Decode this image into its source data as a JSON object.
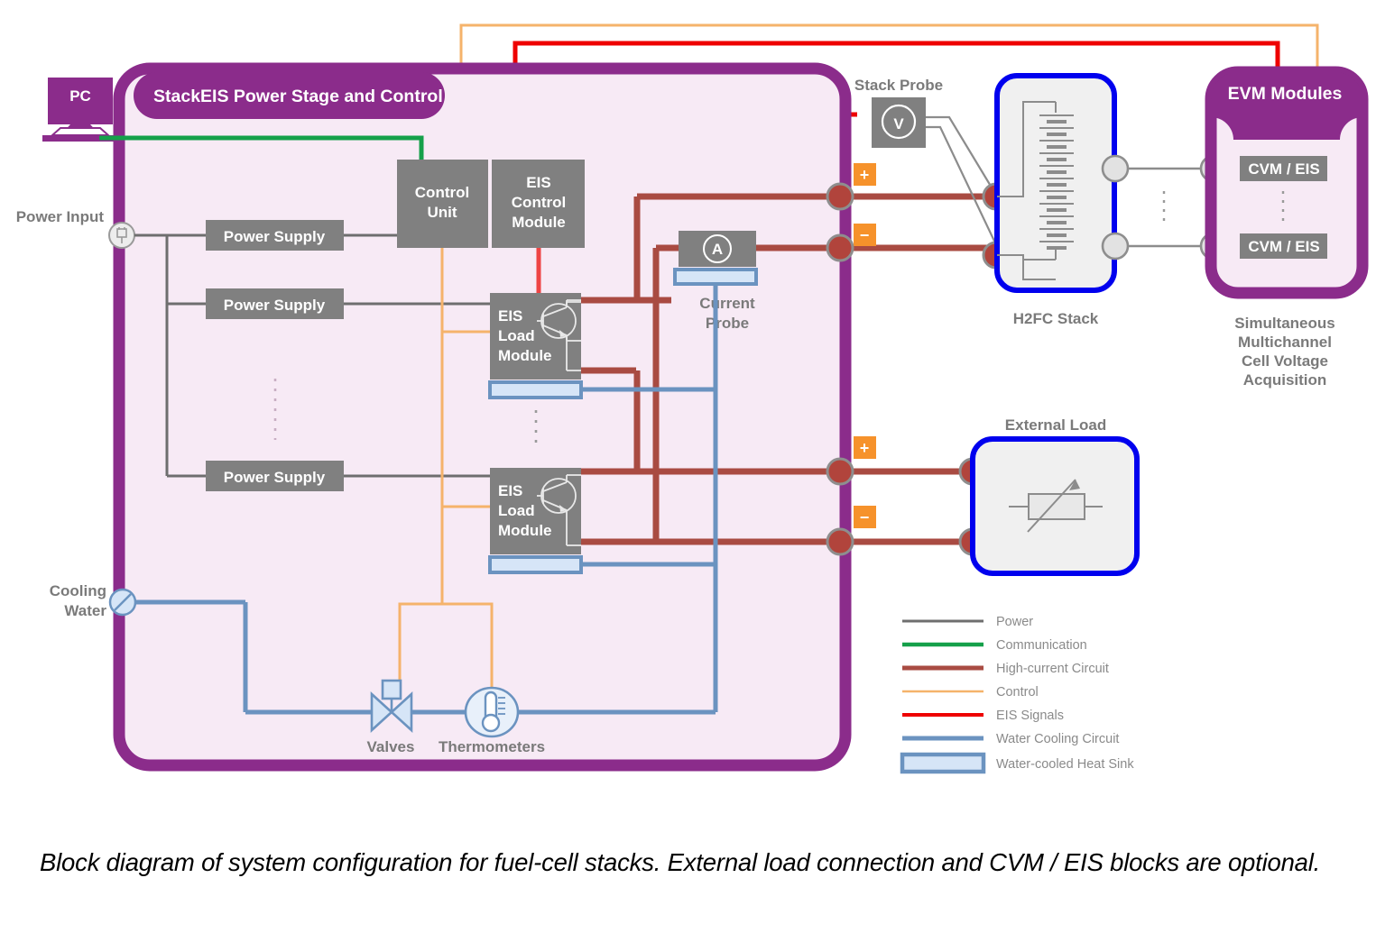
{
  "diagram": {
    "title": "Block diagram of system configuration for fuel-cell stacks",
    "caption": "Block diagram of system configuration for fuel-cell stacks. External load connection and CVM / EIS blocks are optional."
  },
  "colors": {
    "purple": "#8B2C8B",
    "purple_fill": "#F7EAF5",
    "grey_block": "#808080",
    "power_line": "#6E6E6E",
    "communication": "#15A04A",
    "high_current": "#A94B42",
    "control": "#F5B36B",
    "eis_signal": "#EE0000",
    "water_cooling": "#6B93C0",
    "heat_sink_fill": "#D6E5F7",
    "blue_border": "#0000EE",
    "orange_badge": "#F6922B",
    "label_grey": "#7A7A7A",
    "stack_fill": "#F0F0F0"
  },
  "pc": {
    "label": "PC",
    "icon": "desktop-computer-icon"
  },
  "stack_eis": {
    "title": "StackEIS Power Stage and Control",
    "power_input": {
      "label": "Power Input",
      "icon": "power-plug-icon"
    },
    "cooling_water": {
      "label": "Cooling Water",
      "icon": "flow-port-icon"
    },
    "power_supplies": [
      {
        "label": "Power Supply"
      },
      {
        "label": "Power Supply"
      },
      {
        "label": "Power Supply"
      }
    ],
    "power_supply_ellipsis": "⋮",
    "control_unit": {
      "label_line1": "Control",
      "label_line2": "Unit"
    },
    "eis_control_module": {
      "label_line1": "EIS",
      "label_line2": "Control",
      "label_line3": "Module"
    },
    "eis_load_modules": [
      {
        "label_line1": "EIS",
        "label_line2": "Load",
        "label_line3": "Module",
        "symbol": "transistor-icon",
        "heat_sink": "water-cooled-heat-sink"
      },
      {
        "label_line1": "EIS",
        "label_line2": "Load",
        "label_line3": "Module",
        "symbol": "transistor-icon",
        "heat_sink": "water-cooled-heat-sink"
      }
    ],
    "eis_load_ellipsis": "⋮",
    "current_probe": {
      "label_line1": "Current",
      "label_line2": "Probe",
      "symbol": "A",
      "heat_sink": "water-cooled-heat-sink"
    },
    "valves": {
      "label": "Valves",
      "icon": "valve-icon"
    },
    "thermometers": {
      "label": "Thermometers",
      "icon": "thermometer-icon"
    }
  },
  "stack_probe": {
    "label": "Stack Probe",
    "symbol": "V"
  },
  "terminals": {
    "stack_plus": "+",
    "stack_minus": "−",
    "load_plus": "+",
    "load_minus": "−"
  },
  "h2fc_stack": {
    "label": "H2FC Stack",
    "symbol": "cell-stack-icon"
  },
  "external_load": {
    "label": "External Load",
    "symbol": "variable-resistor-icon"
  },
  "evm": {
    "title": "EVM Modules",
    "modules": [
      {
        "label": "CVM / EIS"
      },
      {
        "label": "CVM / EIS"
      }
    ],
    "ellipsis": "⋮",
    "caption_line1": "Simultaneous",
    "caption_line2": "Multichannel",
    "caption_line3": "Cell Voltage",
    "caption_line4": "Acquisition"
  },
  "legend": {
    "items": [
      {
        "label": "Power",
        "color": "#6E6E6E",
        "style": "line",
        "width": 3
      },
      {
        "label": "Communication",
        "color": "#15A04A",
        "style": "line",
        "width": 4.5
      },
      {
        "label": "High-current Circuit",
        "color": "#A94B42",
        "style": "line",
        "width": 5
      },
      {
        "label": "Control",
        "color": "#F5B36B",
        "style": "line",
        "width": 2.5
      },
      {
        "label": "EIS Signals",
        "color": "#EE0000",
        "style": "line",
        "width": 4
      },
      {
        "label": "Water Cooling Circuit",
        "color": "#6B93C0",
        "style": "line",
        "width": 5
      },
      {
        "label": "Water-cooled Heat Sink",
        "color": "#6B93C0",
        "style": "swatch",
        "width": 0
      }
    ]
  }
}
